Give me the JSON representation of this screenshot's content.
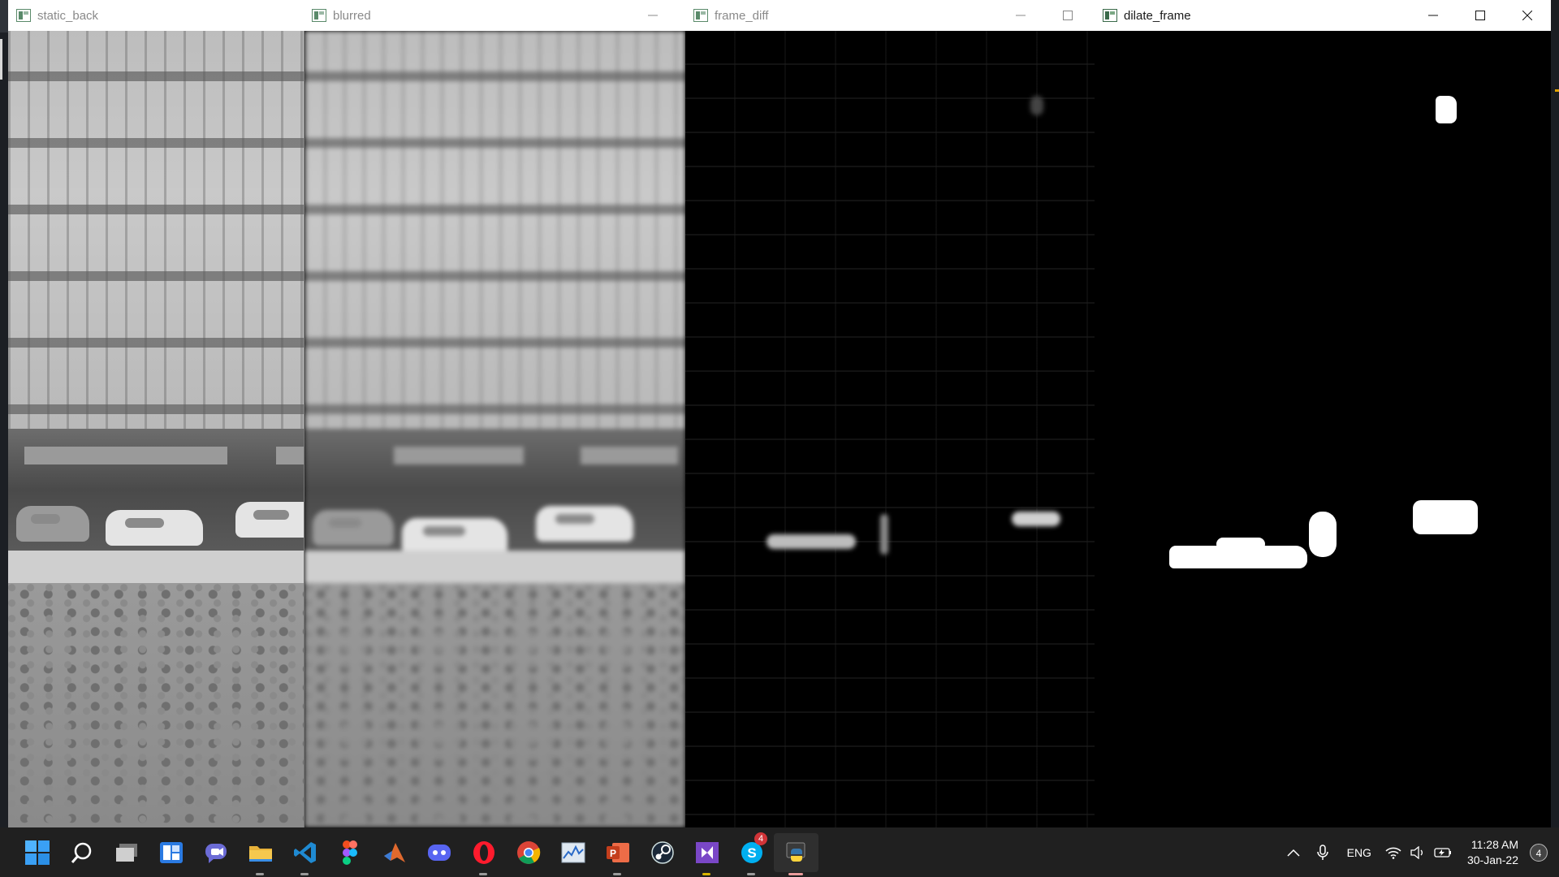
{
  "windows": {
    "static_back": {
      "title": "static_back"
    },
    "blurred": {
      "title": "blurred"
    },
    "frame_diff": {
      "title": "frame_diff"
    },
    "dilate_frame": {
      "title": "dilate_frame"
    }
  },
  "taskbar": {
    "apps": [
      {
        "name": "start",
        "icon": "windows-logo-icon"
      },
      {
        "name": "search",
        "icon": "search-icon"
      },
      {
        "name": "task-view",
        "icon": "task-view-icon"
      },
      {
        "name": "widgets",
        "icon": "widgets-icon"
      },
      {
        "name": "chat",
        "icon": "chat-icon"
      },
      {
        "name": "file-explorer",
        "icon": "folder-icon"
      },
      {
        "name": "vscode",
        "icon": "vscode-icon"
      },
      {
        "name": "figma",
        "icon": "figma-icon"
      },
      {
        "name": "matlab",
        "icon": "matlab-icon"
      },
      {
        "name": "discord",
        "icon": "discord-icon"
      },
      {
        "name": "opera",
        "icon": "opera-icon"
      },
      {
        "name": "chrome",
        "icon": "chrome-icon"
      },
      {
        "name": "resource-monitor",
        "icon": "chart-icon"
      },
      {
        "name": "powerpoint",
        "icon": "powerpoint-icon"
      },
      {
        "name": "steam",
        "icon": "steam-icon"
      },
      {
        "name": "visual-studio",
        "icon": "visual-studio-icon"
      },
      {
        "name": "skype",
        "icon": "skype-icon",
        "badge": "4"
      },
      {
        "name": "python",
        "icon": "python-icon"
      }
    ],
    "tray": {
      "language": "ENG",
      "time": "11:28 AM",
      "date": "30-Jan-22",
      "notification_count": "4"
    }
  },
  "colors": {
    "taskbar_bg": "#202020",
    "titlebar_bg": "#ffffff",
    "accent_blue": "#0078d4"
  }
}
